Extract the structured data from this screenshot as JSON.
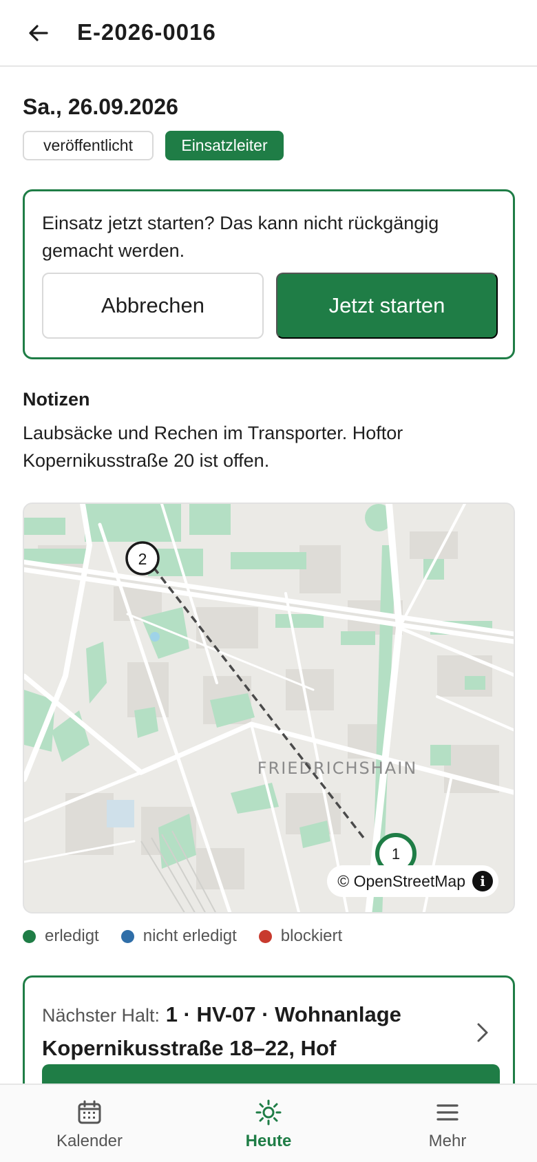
{
  "header": {
    "title": "E-2026-0016",
    "back_icon": "arrow-left-icon"
  },
  "event": {
    "date": "Sa., 26.09.2026",
    "status_chip": "veröffentlicht",
    "role_chip": "Einsatzleiter"
  },
  "confirm": {
    "message": "Einsatz jetzt starten? Das kann nicht rückgängig gemacht werden.",
    "cancel_label": "Abbrechen",
    "start_label": "Jetzt starten"
  },
  "notes": {
    "heading": "Notizen",
    "text": "Laubsäcke und Rechen im Transporter. Hoftor Kopernikusstraße 20 ist offen."
  },
  "map": {
    "district_label": "FRIEDRICHSHAIN",
    "attribution": "© OpenStreetMap",
    "info_icon": "info-icon",
    "markers": [
      {
        "label": "1",
        "status": "erledigt"
      },
      {
        "label": "2",
        "status": "open"
      }
    ]
  },
  "legend": [
    {
      "label": "erledigt",
      "color": "#1f7d46"
    },
    {
      "label": "nicht erledigt",
      "color": "#2f6ea8"
    },
    {
      "label": "blockiert",
      "color": "#c83a2e"
    }
  ],
  "next_stop": {
    "label": "Nächster Halt:",
    "value": "1 · HV-07 · Wohnanlage Kopernikusstraße 18–22, Hof",
    "chevron_icon": "chevron-right-icon"
  },
  "nav": {
    "items": [
      {
        "label": "Kalender",
        "icon": "calendar-icon",
        "active": false
      },
      {
        "label": "Heute",
        "icon": "sun-icon",
        "active": true
      },
      {
        "label": "Mehr",
        "icon": "menu-icon",
        "active": false
      }
    ]
  },
  "colors": {
    "accent": "#1f7d46",
    "map_background": "#ebeae6",
    "map_park": "#b4dfc4"
  }
}
